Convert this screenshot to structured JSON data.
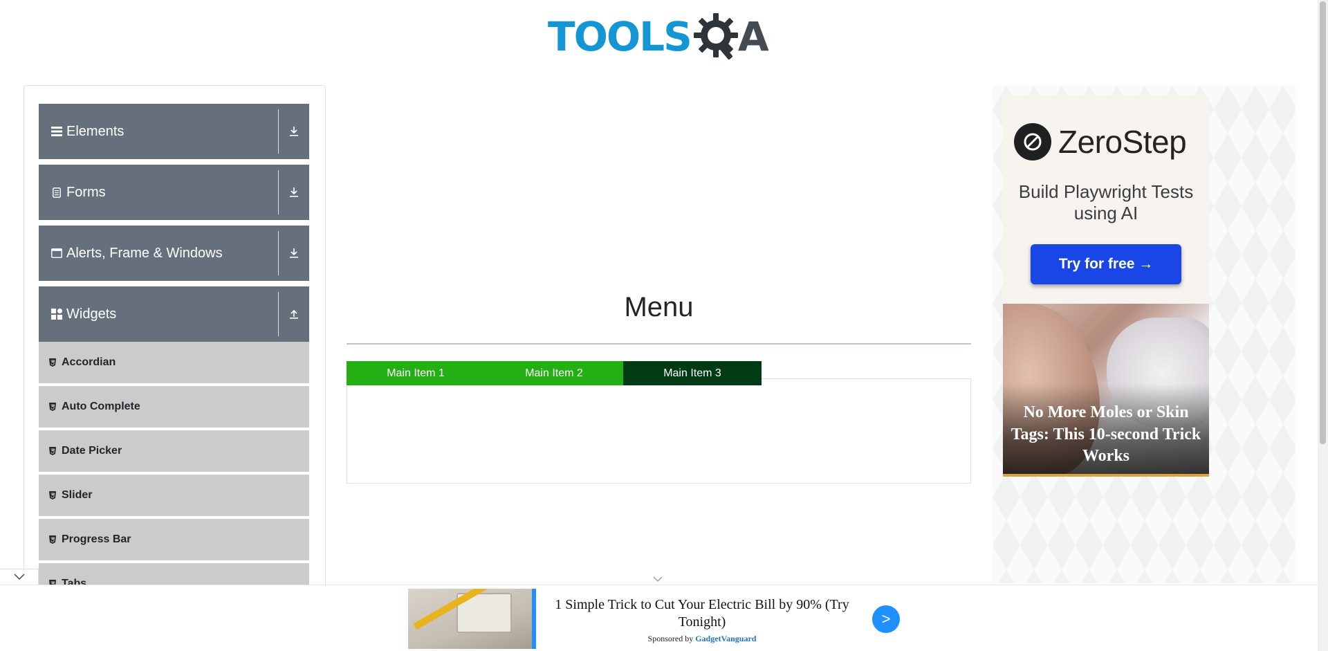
{
  "header": {
    "logo_text_left": "TOOLS",
    "logo_text_right": "A",
    "logo_icon": "gear-magnifier-icon"
  },
  "sidebar": {
    "groups": [
      {
        "label": "Elements",
        "icon": "hamburger-icon",
        "toggle_icon": "download-icon"
      },
      {
        "label": "Forms",
        "icon": "form-icon",
        "toggle_icon": "download-icon"
      },
      {
        "label": "Alerts, Frame & Windows",
        "icon": "window-icon",
        "toggle_icon": "download-icon"
      },
      {
        "label": "Widgets",
        "icon": "widgets-icon",
        "toggle_icon": "upload-icon"
      }
    ],
    "widget_items": [
      {
        "label": "Accordian"
      },
      {
        "label": "Auto Complete"
      },
      {
        "label": "Date Picker"
      },
      {
        "label": "Slider"
      },
      {
        "label": "Progress Bar"
      },
      {
        "label": "Tabs"
      }
    ],
    "collapse_icon": "chevron-down-icon"
  },
  "main": {
    "title": "Menu",
    "menu_items": [
      {
        "label": "Main Item 1"
      },
      {
        "label": "Main Item 2"
      },
      {
        "label": "Main Item 3"
      }
    ]
  },
  "right_ad": {
    "brand": "ZeroStep",
    "tagline": "Build Playwright Tests using AI",
    "cta": "Try for free →",
    "promo_headline": "No More Moles or Skin Tags: This 10-second Trick Works"
  },
  "bottom_ad": {
    "headline": "1 Simple Trick to Cut Your Electric Bill by 90% (Try Tonight)",
    "sponsored_prefix": "Sponsored by",
    "sponsor": "GadgetVanguard",
    "go_label": ">"
  },
  "colors": {
    "group_bg": "#66707c",
    "item_bg": "#cbcbcb",
    "menu_green": "#24af15",
    "menu_dark": "#003b14",
    "logo_blue": "#1596d4",
    "cta_blue": "#1a46e6"
  }
}
